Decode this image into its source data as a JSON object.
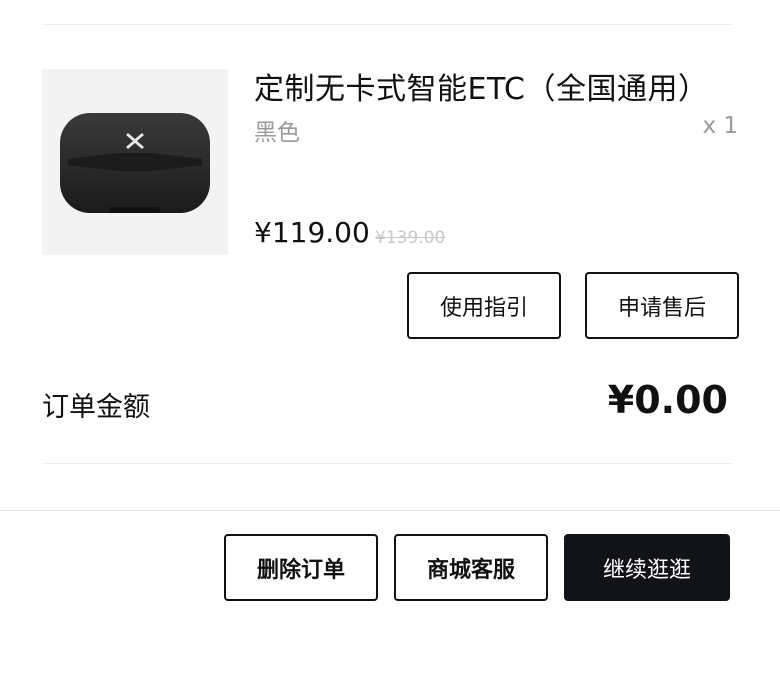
{
  "order_item": {
    "product_name": "定制无卡式智能ETC（全国通用）",
    "variant": "黑色",
    "quantity": "x 1",
    "price": "¥119.00",
    "original_price": "¥139.00",
    "image_icon": "etc-device-icon"
  },
  "item_actions": {
    "guide_label": "使用指引",
    "after_sales_label": "申请售后"
  },
  "summary": {
    "amount_label": "订单金额",
    "amount_value": "¥0.00"
  },
  "footer_actions": {
    "delete_label": "删除订单",
    "service_label": "商城客服",
    "continue_label": "继续逛逛"
  },
  "colors": {
    "primary_dark": "#111318",
    "muted_text": "#9a9a9a",
    "strikethrough_text": "#c9c9c9",
    "divider": "#ececec"
  }
}
